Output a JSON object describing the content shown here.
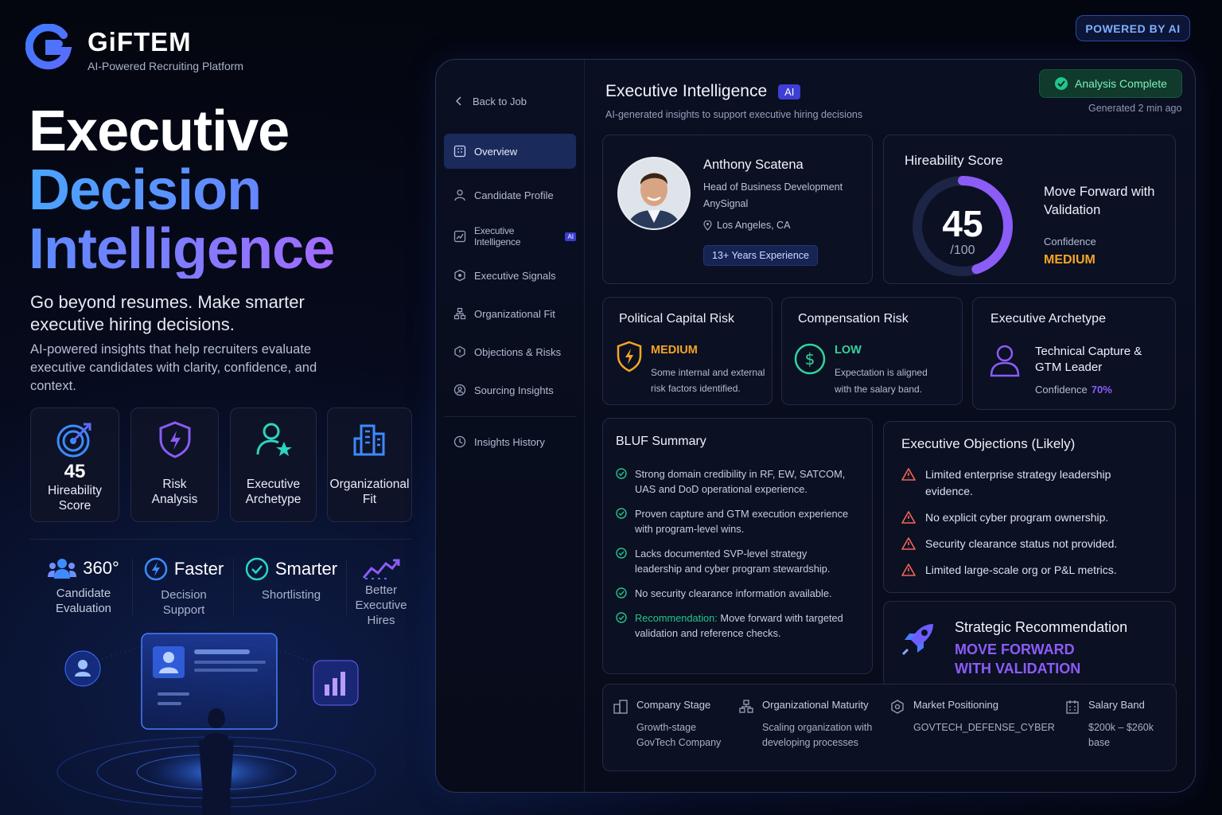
{
  "brand": {
    "name": "GiFTEM",
    "tagline": "AI-Powered Recruiting Platform",
    "badge": "POWERED BY AI"
  },
  "hero": {
    "line1": "Executive",
    "line2": "Decision",
    "line3": "Intelligence",
    "subtitle": "Go beyond resumes. Make smarter executive hiring decisions.",
    "description": "AI-powered insights that help recruiters evaluate executive candidates with clarity, confidence, and context."
  },
  "features": [
    {
      "value": "45",
      "label": "Hireability Score",
      "icon": "target-icon"
    },
    {
      "label": "Risk Analysis",
      "icon": "shield-bolt-icon"
    },
    {
      "label": "Executive Archetype",
      "icon": "user-star-icon"
    },
    {
      "label": "Organizational Fit",
      "icon": "building-icon"
    }
  ],
  "stats": [
    {
      "value": "360°",
      "label": "Candidate Evaluation",
      "icon": "people-icon"
    },
    {
      "value": "Faster",
      "label": "Decision Support",
      "icon": "bolt-circle-icon"
    },
    {
      "value": "Smarter",
      "label": "Shortlisting",
      "icon": "check-circle-icon"
    },
    {
      "label": "Better Executive Hires",
      "icon": "trend-up-icon"
    }
  ],
  "sidebar": {
    "back": "Back to Job",
    "items": [
      {
        "label": "Overview",
        "icon": "grid-icon",
        "active": true
      },
      {
        "label": "Candidate Profile",
        "icon": "user-icon"
      },
      {
        "label": "Executive Intelligence",
        "icon": "chart-icon",
        "badge": "AI"
      },
      {
        "label": "Executive Signals",
        "icon": "signal-icon"
      },
      {
        "label": "Organizational Fit",
        "icon": "org-icon"
      },
      {
        "label": "Objections & Risks",
        "icon": "hex-icon"
      },
      {
        "label": "Sourcing Insights",
        "icon": "search-user-icon"
      }
    ],
    "history": "Insights History"
  },
  "header": {
    "title": "Executive Intelligence",
    "badge": "AI",
    "subtitle": "AI-generated insights to support executive hiring decisions",
    "status": "Analysis Complete",
    "generated": "Generated 2 min ago"
  },
  "candidate": {
    "name": "Anthony Scatena",
    "role": "Head of Business Development",
    "company": "AnySignal",
    "location": "Los Angeles, CA",
    "experience": "13+ Years Experience"
  },
  "hireability": {
    "title": "Hireability Score",
    "score": "45",
    "out_of": "/100",
    "score_fraction": 0.45,
    "verdict": "Move Forward with Validation",
    "confidence_label": "Confidence",
    "confidence": "MEDIUM"
  },
  "risks": {
    "political": {
      "title": "Political Capital Risk",
      "level": "MEDIUM",
      "desc": "Some internal and external risk factors identified."
    },
    "compensation": {
      "title": "Compensation Risk",
      "level": "LOW",
      "desc": "Expectation is aligned with the salary band."
    },
    "archetype": {
      "title": "Executive Archetype",
      "value": "Technical Capture & GTM Leader",
      "confidence_label": "Confidence",
      "confidence": "70%"
    }
  },
  "bluf": {
    "title": "BLUF Summary",
    "items": [
      "Strong domain credibility in RF, EW, SATCOM, UAS and DoD operational experience.",
      "Proven capture and GTM execution experience with program-level wins.",
      "Lacks documented SVP-level strategy leadership and cyber program stewardship.",
      "No security clearance information available."
    ],
    "rec_label": "Recommendation:",
    "rec_text": "Move forward with targeted validation and reference checks."
  },
  "objections": {
    "title": "Executive Objections (Likely)",
    "items": [
      "Limited enterprise strategy leadership evidence.",
      "No explicit cyber program ownership.",
      "Security clearance status not provided.",
      "Limited large-scale org or P&L metrics."
    ]
  },
  "strategic": {
    "title": "Strategic Recommendation",
    "line1": "MOVE FORWARD",
    "line2": "WITH VALIDATION"
  },
  "footer": [
    {
      "title": "Company Stage",
      "value": "Growth-stage GovTech Company",
      "icon": "building-icon"
    },
    {
      "title": "Organizational Maturity",
      "value": "Scaling organization with developing processes",
      "icon": "org-icon"
    },
    {
      "title": "Market Positioning",
      "value": "GOVTECH_DEFENSE_CYBER",
      "icon": "target-icon"
    },
    {
      "title": "Salary Band",
      "value": "$200k – $260k base",
      "icon": "building-icon"
    }
  ],
  "colors": {
    "accent_blue": "#4aa3ff",
    "accent_purple": "#8b5cf6",
    "medium": "#f5a524",
    "low": "#34d399",
    "risk_red": "#f2665a"
  }
}
